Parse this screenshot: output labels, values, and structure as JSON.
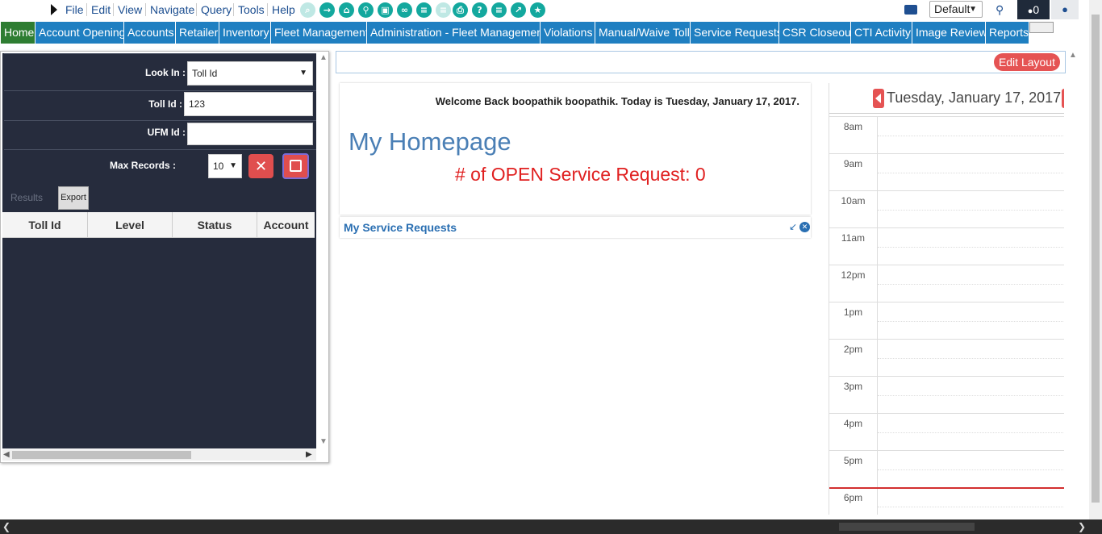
{
  "menu": [
    "File",
    "Edit",
    "View",
    "Navigate",
    "Query",
    "Tools",
    "Help"
  ],
  "toolbar_icons": [
    "search-icon",
    "go-icon",
    "home-icon",
    "key-icon",
    "clipboard-icon",
    "link-icon",
    "list-icon",
    "document-icon",
    "print-icon",
    "help-icon",
    "notes-icon",
    "chart-icon",
    "star-icon"
  ],
  "profile_select": "Default",
  "message_count": "0",
  "nav_tabs": [
    "Home",
    "Account Opening",
    "Accounts",
    "Retailer",
    "Inventory",
    "Fleet Management",
    "Administration - Fleet Management",
    "Violations",
    "Manual/Waive Toll",
    "Service Requests",
    "CSR Closeout",
    "CTI Activity",
    "Image Review",
    "Reports"
  ],
  "search_panel": {
    "look_in_label": "Look In :",
    "look_in_value": "Toll Id",
    "toll_id_label": "Toll Id :",
    "toll_id_value": "123",
    "ufm_id_label": "UFM Id :",
    "ufm_id_value": "",
    "max_records_label": "Max Records :",
    "max_records_value": "10",
    "results_tab": "Results",
    "export_button": "Export",
    "columns": [
      "Toll Id",
      "Level",
      "Status",
      "Account"
    ]
  },
  "edit_layout_button": "Edit Layout",
  "welcome_text": "Welcome Back boopathik boopathik.  Today is Tuesday, January 17, 2017.",
  "homepage_title": "My Homepage",
  "open_sr_text": "# of OPEN Service Request: 0",
  "service_requests_title": "My Service Requests",
  "calendar": {
    "date": "Tuesday, January 17, 2017",
    "hours": [
      "8am",
      "9am",
      "10am",
      "11am",
      "12pm",
      "1pm",
      "2pm",
      "3pm",
      "4pm",
      "5pm",
      "6pm"
    ]
  },
  "colors": {
    "nav_blue": "#1f7fc1",
    "nav_active": "#2e7d32",
    "panel_dark": "#262c3d",
    "accent_red": "#e55353",
    "teal_icon": "#13a89e"
  }
}
